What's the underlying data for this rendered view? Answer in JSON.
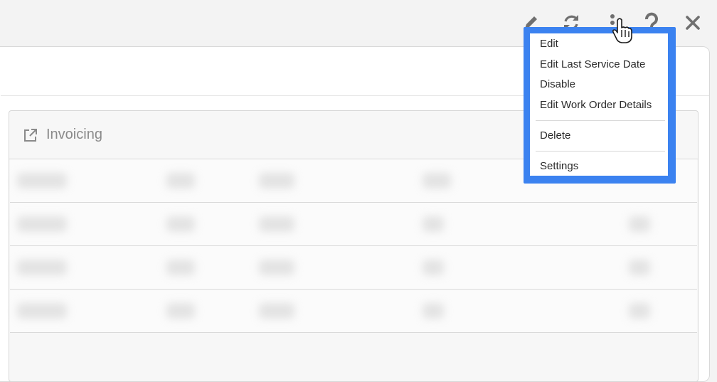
{
  "toolbar": {
    "icons": [
      "pencil-icon",
      "refresh-icon",
      "more-vertical-icon",
      "help-icon",
      "close-icon"
    ]
  },
  "card": {
    "title": "Invoicing",
    "title_icon": "external-link-icon"
  },
  "dropdown": {
    "items": [
      {
        "label": "Edit"
      },
      {
        "label": "Edit Last Service Date"
      },
      {
        "label": "Disable"
      },
      {
        "label": "Edit Work Order Details"
      },
      {
        "label": "Delete"
      },
      {
        "label": "Settings"
      }
    ],
    "highlight_color": "#3b82f0"
  },
  "colors": {
    "background": "#f3f3f3",
    "panel": "#ffffff",
    "icon_gray": "#6f6f6f",
    "title_gray": "#8a8a8a"
  }
}
